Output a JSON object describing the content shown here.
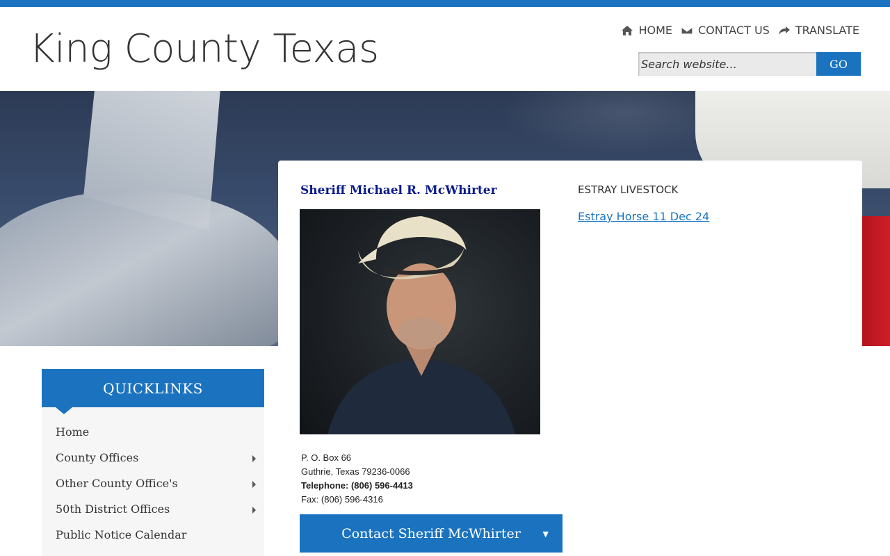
{
  "site": {
    "title": "King County Texas"
  },
  "top_nav": [
    {
      "label": "HOME",
      "icon": "home-icon"
    },
    {
      "label": "CONTACT US",
      "icon": "envelope-icon"
    },
    {
      "label": "TRANSLATE",
      "icon": "share-arrow-icon"
    }
  ],
  "search": {
    "placeholder": "Search website...",
    "button_label": "GO"
  },
  "sheriff": {
    "title": "Sheriff Michael R. McWhirter",
    "address_line1": "P. O. Box 66",
    "address_line2": "Guthrie, Texas 79236-0066",
    "telephone": "Telephone: (806) 596-4413",
    "fax": "Fax: (806) 596-4316",
    "contact_button": "Contact Sheriff McWhirter"
  },
  "estray": {
    "heading": "ESTRAY LIVESTOCK",
    "link": "Estray Horse 11 Dec 24"
  },
  "quicklinks": {
    "heading": "QUICKLINKS",
    "items": [
      {
        "label": "Home",
        "has_submenu": false
      },
      {
        "label": "County Offices",
        "has_submenu": true
      },
      {
        "label": "Other County Office's",
        "has_submenu": true
      },
      {
        "label": "50th District Offices",
        "has_submenu": true
      },
      {
        "label": "Public Notice Calendar",
        "has_submenu": false
      }
    ]
  },
  "colors": {
    "accent": "#1b73bf",
    "sheriff_title": "#0a1a8a"
  }
}
